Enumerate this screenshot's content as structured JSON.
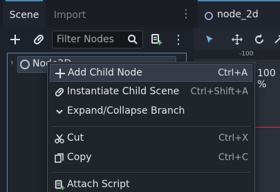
{
  "scene_dock": {
    "tabs": [
      {
        "label": "Scene",
        "active": true
      },
      {
        "label": "Import",
        "active": false
      }
    ],
    "filter_placeholder": "Filter Nodes",
    "tree": {
      "root_label": "Node2D"
    }
  },
  "editor": {
    "tab_label": "node_2d",
    "ruler_label": "-100",
    "zoom_label": "100 %"
  },
  "context_menu": {
    "items": [
      {
        "label": "Add Child Node",
        "shortcut": "Ctrl+A",
        "icon": "plus-icon",
        "highlighted": true
      },
      {
        "label": "Instantiate Child Scene",
        "shortcut": "Ctrl+Shift+A",
        "icon": "link-icon"
      },
      {
        "label": "Expand/Collapse Branch",
        "shortcut": "",
        "icon": "chevron-down-icon"
      },
      {
        "label": "Cut",
        "shortcut": "Ctrl+X",
        "icon": "scissors-icon"
      },
      {
        "label": "Copy",
        "shortcut": "Ctrl+C",
        "icon": "copy-icon"
      },
      {
        "label": "Attach Script",
        "shortcut": "",
        "icon": "script-icon"
      }
    ]
  },
  "colors": {
    "accent": "#478cbf",
    "background": "#1d2129",
    "menu_highlight": "#353c48",
    "axis_red": "#c9404a"
  }
}
